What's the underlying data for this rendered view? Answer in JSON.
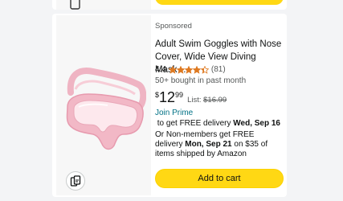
{
  "product": {
    "sponsored_label": "Sponsored",
    "title": "Adult Swim Goggles with Nose Cover, Wide View Diving Mask…",
    "rating_value": "4.4",
    "rating_stars": 4.4,
    "rating_count": "(81)",
    "bought_text": "50+ bought in past month",
    "price_symbol": "$",
    "price_whole": "12",
    "price_fraction": "99",
    "list_label": "List:",
    "list_price": "$16.99",
    "join_prime": "Join Prime",
    "delivery_text": " to get FREE delivery ",
    "delivery_date": "Wed, Sep 16",
    "nonmember_text": "Or Non-members get FREE delivery ",
    "nonmember_date": "Mon, Sep 21",
    "nonmember_rest": " on $35 of items shipped by Amazon",
    "add_to_cart": "Add to cart",
    "image": "pink-swim-goggles-with-nose-cover"
  },
  "icons": {
    "compare": "compare-icon",
    "star": "star-icon"
  },
  "colors": {
    "button_yellow": "#ffd814",
    "star_orange": "#de7921",
    "link_teal": "#007185",
    "goggle_pink": "#f2b8c6"
  }
}
